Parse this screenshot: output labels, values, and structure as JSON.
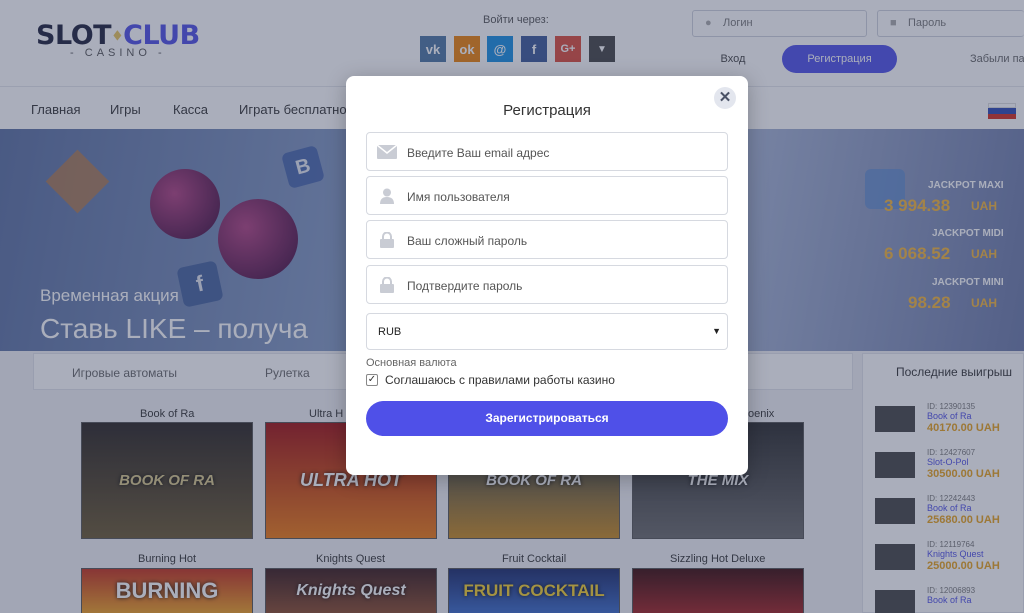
{
  "header": {
    "logo": {
      "slot": "SLOT",
      "club": "CLUB",
      "sub": "- CASINO -"
    },
    "login_via": "Войти через:",
    "social": [
      {
        "icon": "vk-icon",
        "label": "vk",
        "color": "#4c75a3"
      },
      {
        "icon": "odnoklassniki-icon",
        "label": "ok",
        "color": "#ee8208"
      },
      {
        "icon": "mail-icon",
        "label": "@",
        "color": "#168de2"
      },
      {
        "icon": "facebook-icon",
        "label": "f",
        "color": "#3b5998"
      },
      {
        "icon": "google-plus-icon",
        "label": "G+",
        "color": "#dd4b39"
      },
      {
        "icon": "more-icon",
        "label": "▼",
        "color": "#444444"
      }
    ],
    "login_placeholder": "Логин",
    "password_placeholder": "Пароль",
    "login_button": "Вход",
    "register_button": "Регистрация",
    "forgot": "Забыли па"
  },
  "nav": {
    "items": [
      "Главная",
      "Игры",
      "Касса",
      "Играть бесплатно"
    ]
  },
  "banner": {
    "promo_sub": "Временная акция",
    "promo_title": "Ставь LIKE – получа",
    "jackpots": [
      {
        "label": "JACKPOT MAXI",
        "value": "3 994.38",
        "currency": "UAH"
      },
      {
        "label": "JACKPOT MIDI",
        "value": "6 068.52",
        "currency": "UAH"
      },
      {
        "label": "JACKPOT MINI",
        "value": "98.28",
        "currency": "UAH"
      }
    ]
  },
  "tabs": [
    "Игровые автоматы",
    "Рулетка"
  ],
  "games_row1": [
    "Book of Ra",
    "Ultra H",
    "",
    "oenix"
  ],
  "games_row1_art": [
    "BOOK OF RA",
    "ULTRA HOT",
    "BOOK OF RA",
    "THE MIX"
  ],
  "games_row2": [
    "Burning Hot",
    "Knights Quest",
    "Fruit Cocktail",
    "Sizzling Hot Deluxe"
  ],
  "games_row2_art": [
    "BURNING",
    "Knights Quest",
    "FRUIT COCKTAIL",
    ""
  ],
  "sidebar": {
    "title": "Последние выигрыш",
    "wins": [
      {
        "id": "ID: 12390135",
        "game": "Book of Ra",
        "amount": "40170.00 UAH"
      },
      {
        "id": "ID: 12427607",
        "game": "Slot-O-Pol",
        "amount": "30500.00 UAH"
      },
      {
        "id": "ID: 12242443",
        "game": "Book of Ra",
        "amount": "25680.00 UAH"
      },
      {
        "id": "ID: 12119764",
        "game": "Knights Quest",
        "amount": "25000.00 UAH"
      },
      {
        "id": "ID: 12006893",
        "game": "Book of Ra",
        "amount": ""
      }
    ]
  },
  "modal": {
    "title": "Регистрация",
    "close": "✕",
    "email_placeholder": "Введите Ваш email адрес",
    "username_placeholder": "Имя пользователя",
    "password_placeholder": "Ваш сложный пароль",
    "confirm_placeholder": "Подтвердите пароль",
    "currency_value": "RUB",
    "currency_label": "Основная валюта",
    "agree_label": "Соглашаюсь с правилами работы казино",
    "agree_checked": true,
    "submit": "Зарегистрироваться"
  }
}
